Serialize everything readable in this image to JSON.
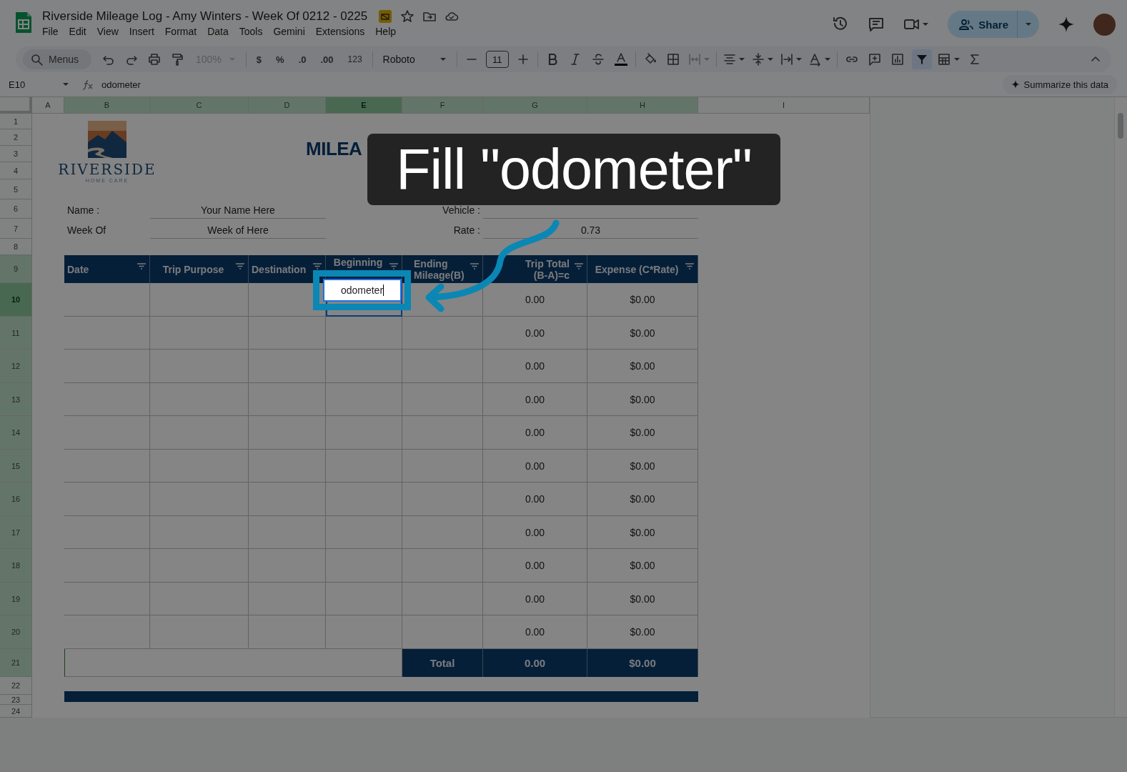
{
  "window": {
    "title": "Riverside Mileage Log - Amy Winters - Week Of 0212 - 0225",
    "menus": [
      "File",
      "Edit",
      "View",
      "Insert",
      "Format",
      "Data",
      "Tools",
      "Gemini",
      "Extensions",
      "Help"
    ],
    "share": "Share"
  },
  "toolbar": {
    "search": "Menus",
    "zoom": "100%",
    "currency": "$",
    "percent": "%",
    "decrease_decimals": ".0",
    "increase_decimals": ".00",
    "number_format": "123",
    "font": "Roboto",
    "font_size": "11",
    "filter_on": true
  },
  "formula_bar": {
    "cell_ref": "E10",
    "formula": "odometer",
    "summarize": "Summarize this data"
  },
  "sheet": {
    "columns": [
      {
        "label": "A",
        "selected": false,
        "filtered": false
      },
      {
        "label": "B",
        "selected": false,
        "filtered": true
      },
      {
        "label": "C",
        "selected": false,
        "filtered": true
      },
      {
        "label": "D",
        "selected": false,
        "filtered": true
      },
      {
        "label": "E",
        "selected": true,
        "filtered": true
      },
      {
        "label": "F",
        "selected": false,
        "filtered": true
      },
      {
        "label": "G",
        "selected": false,
        "filtered": true
      },
      {
        "label": "H",
        "selected": false,
        "filtered": true
      },
      {
        "label": "I",
        "selected": false,
        "filtered": false
      }
    ],
    "rows": [
      {
        "label": "1",
        "selected": false,
        "filtered": false
      },
      {
        "label": "2",
        "selected": false,
        "filtered": false
      },
      {
        "label": "3",
        "selected": false,
        "filtered": false
      },
      {
        "label": "4",
        "selected": false,
        "filtered": false
      },
      {
        "label": "5",
        "selected": false,
        "filtered": false
      },
      {
        "label": "6",
        "selected": false,
        "filtered": false
      },
      {
        "label": "7",
        "selected": false,
        "filtered": false
      },
      {
        "label": "8",
        "selected": false,
        "filtered": false
      },
      {
        "label": "9",
        "selected": false,
        "filtered": true
      },
      {
        "label": "10",
        "selected": true,
        "filtered": true
      },
      {
        "label": "11",
        "selected": false,
        "filtered": true
      },
      {
        "label": "12",
        "selected": false,
        "filtered": true
      },
      {
        "label": "13",
        "selected": false,
        "filtered": true
      },
      {
        "label": "14",
        "selected": false,
        "filtered": true
      },
      {
        "label": "15",
        "selected": false,
        "filtered": true
      },
      {
        "label": "16",
        "selected": false,
        "filtered": true
      },
      {
        "label": "17",
        "selected": false,
        "filtered": true
      },
      {
        "label": "18",
        "selected": false,
        "filtered": true
      },
      {
        "label": "19",
        "selected": false,
        "filtered": true
      },
      {
        "label": "20",
        "selected": false,
        "filtered": true
      },
      {
        "label": "21",
        "selected": false,
        "filtered": true
      },
      {
        "label": "22",
        "selected": false,
        "filtered": false
      },
      {
        "label": "23",
        "selected": false,
        "filtered": false
      },
      {
        "label": "24",
        "selected": false,
        "filtered": false
      }
    ],
    "logo": {
      "name": "RIVERSIDE",
      "tagline": "HOME CARE"
    },
    "title": "MILEA",
    "fields": [
      {
        "label": "Name :",
        "value": "Your Name Here"
      },
      {
        "label": "Week Of",
        "value": "Week of Here"
      },
      {
        "label": "Vehicle :"
      },
      {
        "label": "Rate :",
        "value": "0.73"
      }
    ],
    "table": {
      "columns": [
        "Date",
        "Trip Purpose",
        "Destination",
        "Beginning",
        "Ending Mileage(B)",
        "Trip Total (B-A)=c",
        "Expense (C*Rate)"
      ],
      "rows": [
        {
          "beginning_mileage": "odometer",
          "editing": true,
          "trip_total": "0.00",
          "expense": "$0.00"
        },
        {
          "trip_total": "0.00",
          "expense": "$0.00"
        },
        {
          "trip_total": "0.00",
          "expense": "$0.00"
        },
        {
          "trip_total": "0.00",
          "expense": "$0.00"
        },
        {
          "trip_total": "0.00",
          "expense": "$0.00"
        },
        {
          "trip_total": "0.00",
          "expense": "$0.00"
        },
        {
          "trip_total": "0.00",
          "expense": "$0.00"
        },
        {
          "trip_total": "0.00",
          "expense": "$0.00"
        },
        {
          "trip_total": "0.00",
          "expense": "$0.00"
        },
        {
          "trip_total": "0.00",
          "expense": "$0.00"
        },
        {
          "trip_total": "0.00",
          "expense": "$0.00"
        }
      ],
      "total": {
        "label": "Total",
        "trip_total": "0.00",
        "expense": "$0.00"
      }
    }
  },
  "callout": {
    "text": "Fill \"odometer\""
  }
}
